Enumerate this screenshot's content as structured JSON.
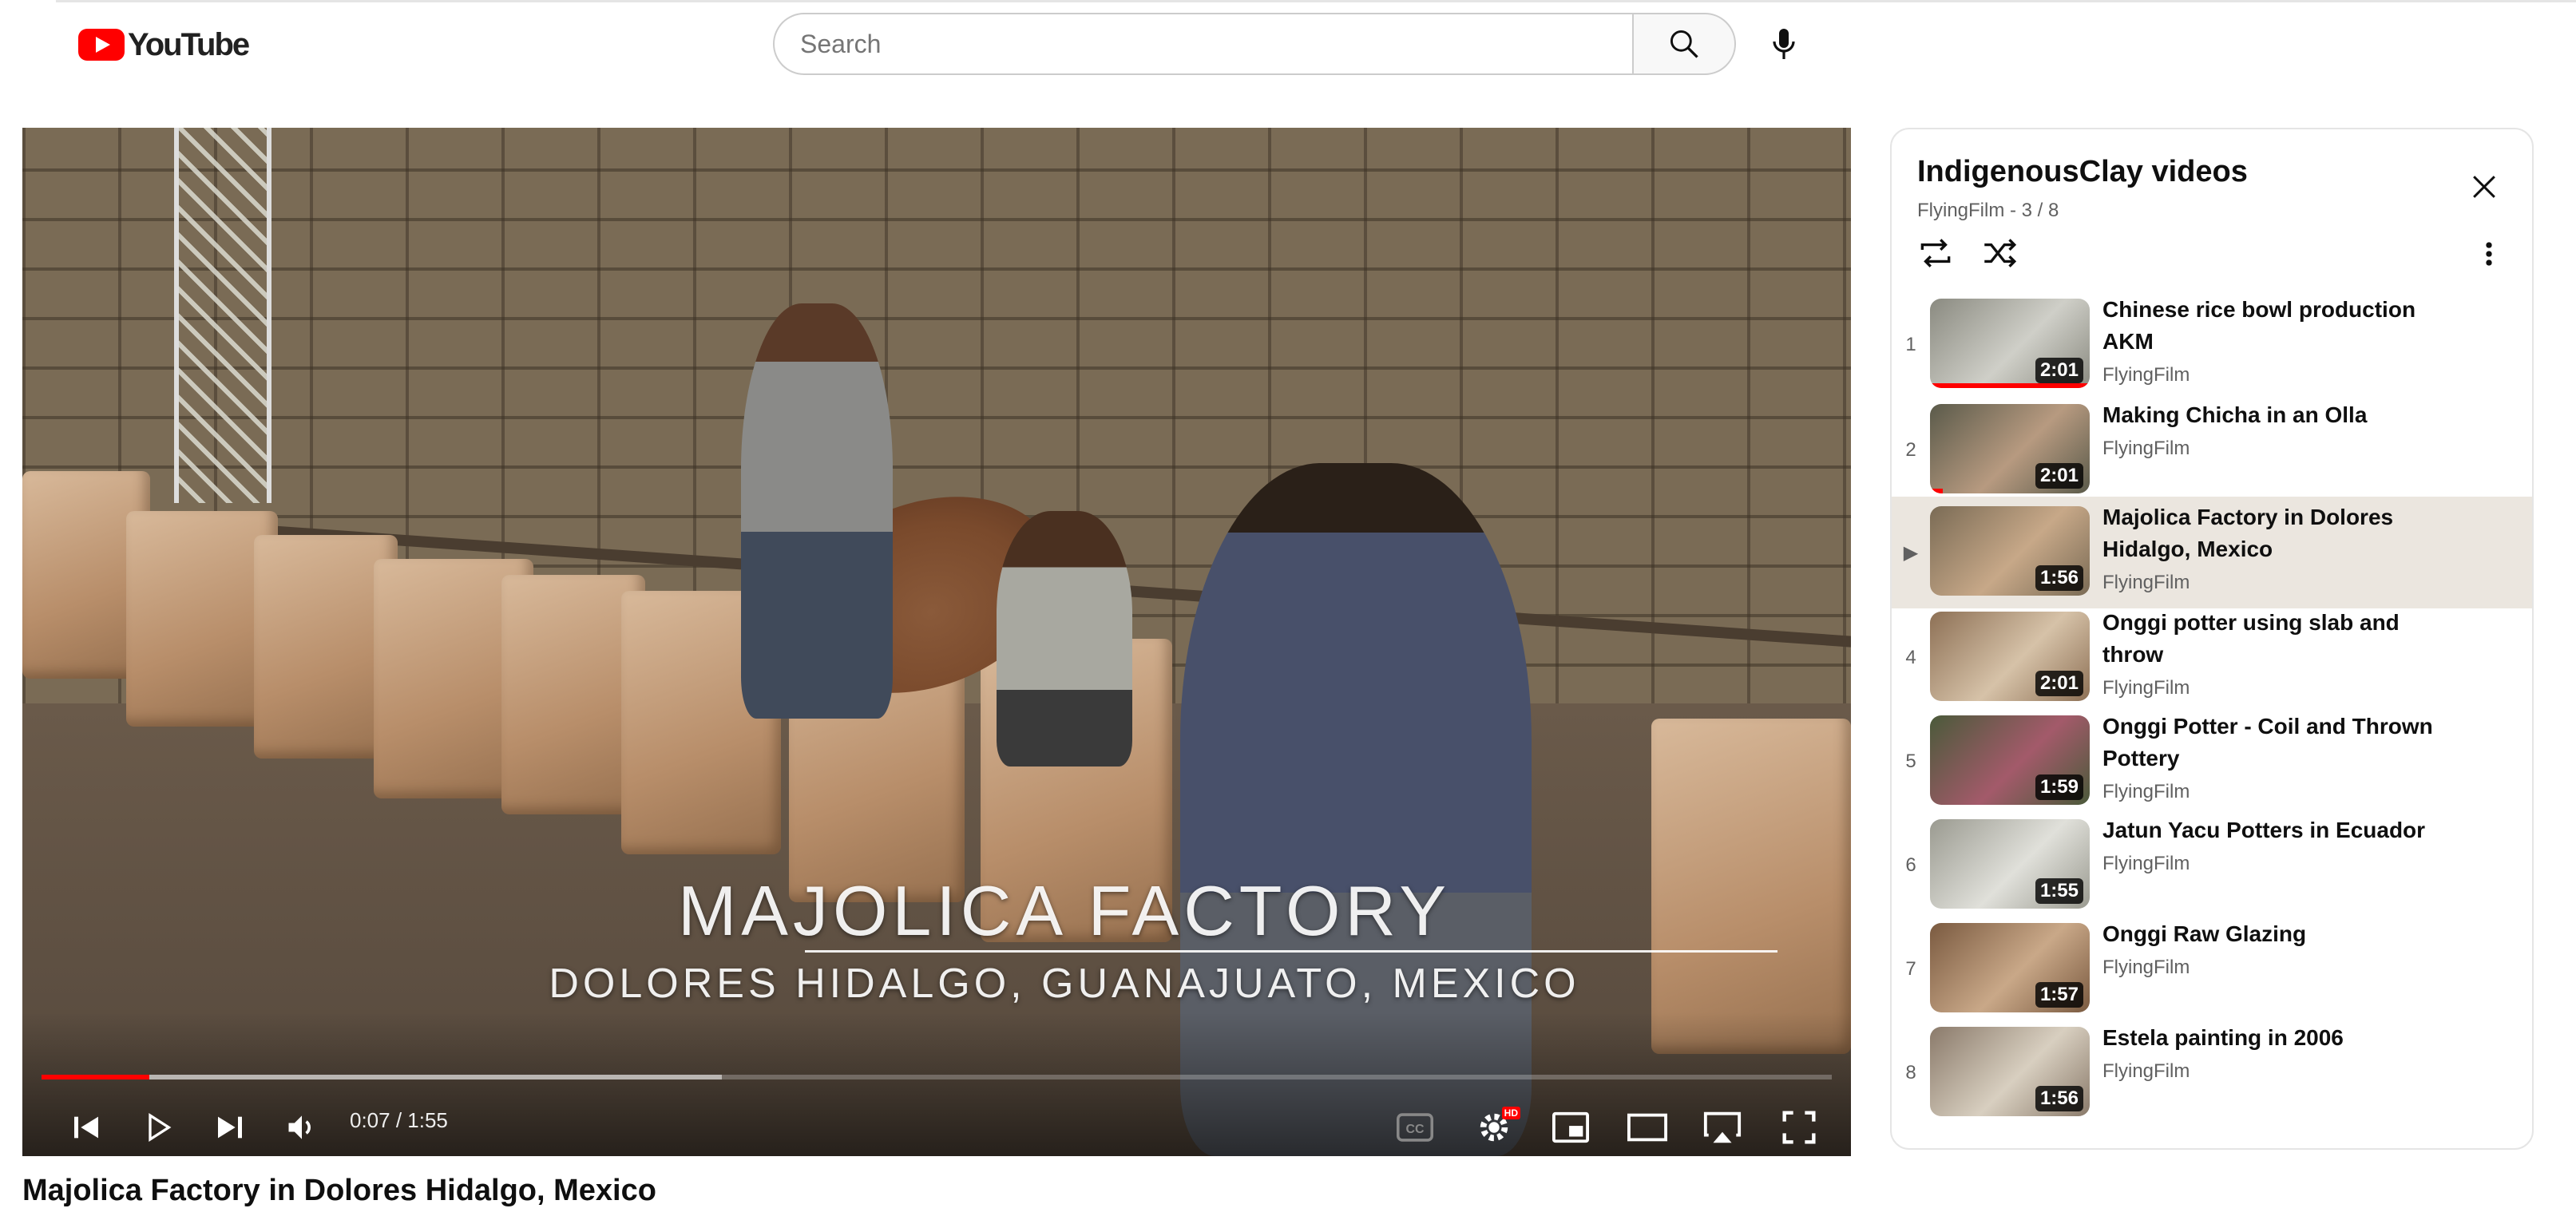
{
  "header": {
    "logo_text": "YouTube",
    "search_placeholder": "Search"
  },
  "player": {
    "overlay_title": "MAJOLICA FACTORY",
    "overlay_subtitle": "DOLORES HIDALGO, GUANAJUATO, MEXICO",
    "current_time": "0:07",
    "duration": "1:55",
    "time_display": "0:07 / 1:55",
    "progress_fraction": 0.06,
    "buffered_fraction": 0.38,
    "quality_badge": "HD"
  },
  "video": {
    "title": "Majolica Factory in Dolores Hidalgo, Mexico"
  },
  "playlist": {
    "title": "IndigenousClay videos",
    "subtitle": "FlyingFilm - 3 / 8",
    "items": [
      {
        "index": "1",
        "title": "Chinese rice bowl production AKM",
        "channel": "FlyingFilm",
        "duration": "2:01",
        "watched_fraction": 1.0,
        "colors": [
          "#8a8a80",
          "#cfcfc8"
        ]
      },
      {
        "index": "2",
        "title": "Making Chicha in an Olla",
        "channel": "FlyingFilm",
        "duration": "2:01",
        "watched_fraction": 0.08,
        "colors": [
          "#5a5a4a",
          "#b79a80"
        ]
      },
      {
        "index": "▶",
        "title": "Majolica Factory in Dolores Hidalgo, Mexico",
        "channel": "FlyingFilm",
        "duration": "1:56",
        "watched_fraction": 0,
        "colors": [
          "#7a6b55",
          "#c7a888"
        ]
      },
      {
        "index": "4",
        "title": "Onggi potter using slab and throw",
        "channel": "FlyingFilm",
        "duration": "2:01",
        "watched_fraction": 0,
        "colors": [
          "#8d7055",
          "#d6c2a8"
        ]
      },
      {
        "index": "5",
        "title": "Onggi Potter - Coil and Thrown Pottery",
        "channel": "FlyingFilm",
        "duration": "1:59",
        "watched_fraction": 0,
        "colors": [
          "#4a5a3a",
          "#a35a6a"
        ]
      },
      {
        "index": "6",
        "title": "Jatun Yacu Potters in Ecuador",
        "channel": "FlyingFilm",
        "duration": "1:55",
        "watched_fraction": 0,
        "colors": [
          "#9a9a90",
          "#e0e0da"
        ]
      },
      {
        "index": "7",
        "title": "Onggi Raw Glazing",
        "channel": "FlyingFilm",
        "duration": "1:57",
        "watched_fraction": 0,
        "colors": [
          "#7a5a40",
          "#c9a888"
        ]
      },
      {
        "index": "8",
        "title": "Estela painting in 2006",
        "channel": "FlyingFilm",
        "duration": "1:56",
        "watched_fraction": 0,
        "colors": [
          "#8a7a6a",
          "#d8cfc0"
        ]
      }
    ]
  },
  "colors": {
    "brand_red": "#ff0000",
    "active_row": "#ebe6df",
    "secondary_text": "#606060"
  }
}
